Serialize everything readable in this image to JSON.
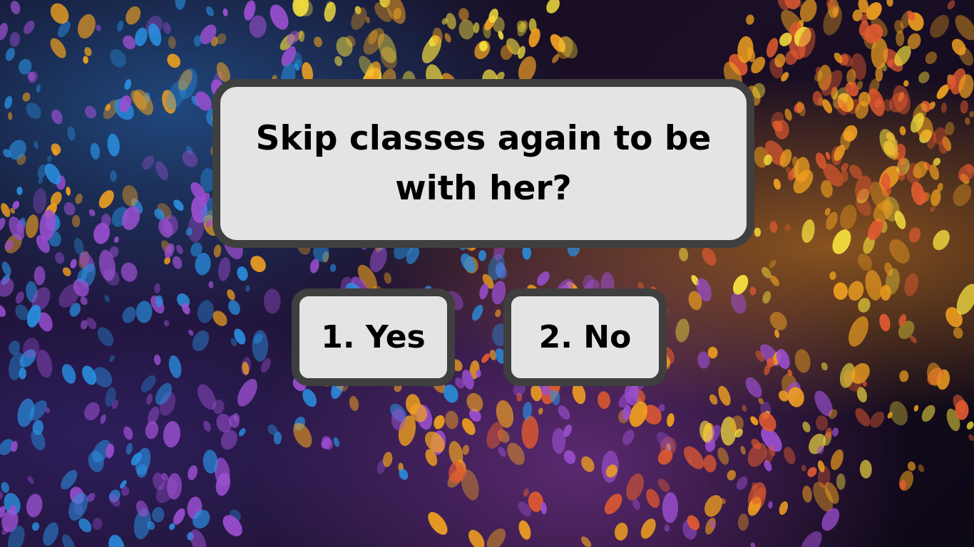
{
  "dialog": {
    "question": "Skip classes again to be with her?",
    "choices": [
      {
        "label": "1. Yes"
      },
      {
        "label": "2. No"
      }
    ]
  },
  "background": {
    "description_colors": [
      "#2a8fe0",
      "#f0a020",
      "#e05a30",
      "#9b4fd0",
      "#f5e040"
    ]
  }
}
